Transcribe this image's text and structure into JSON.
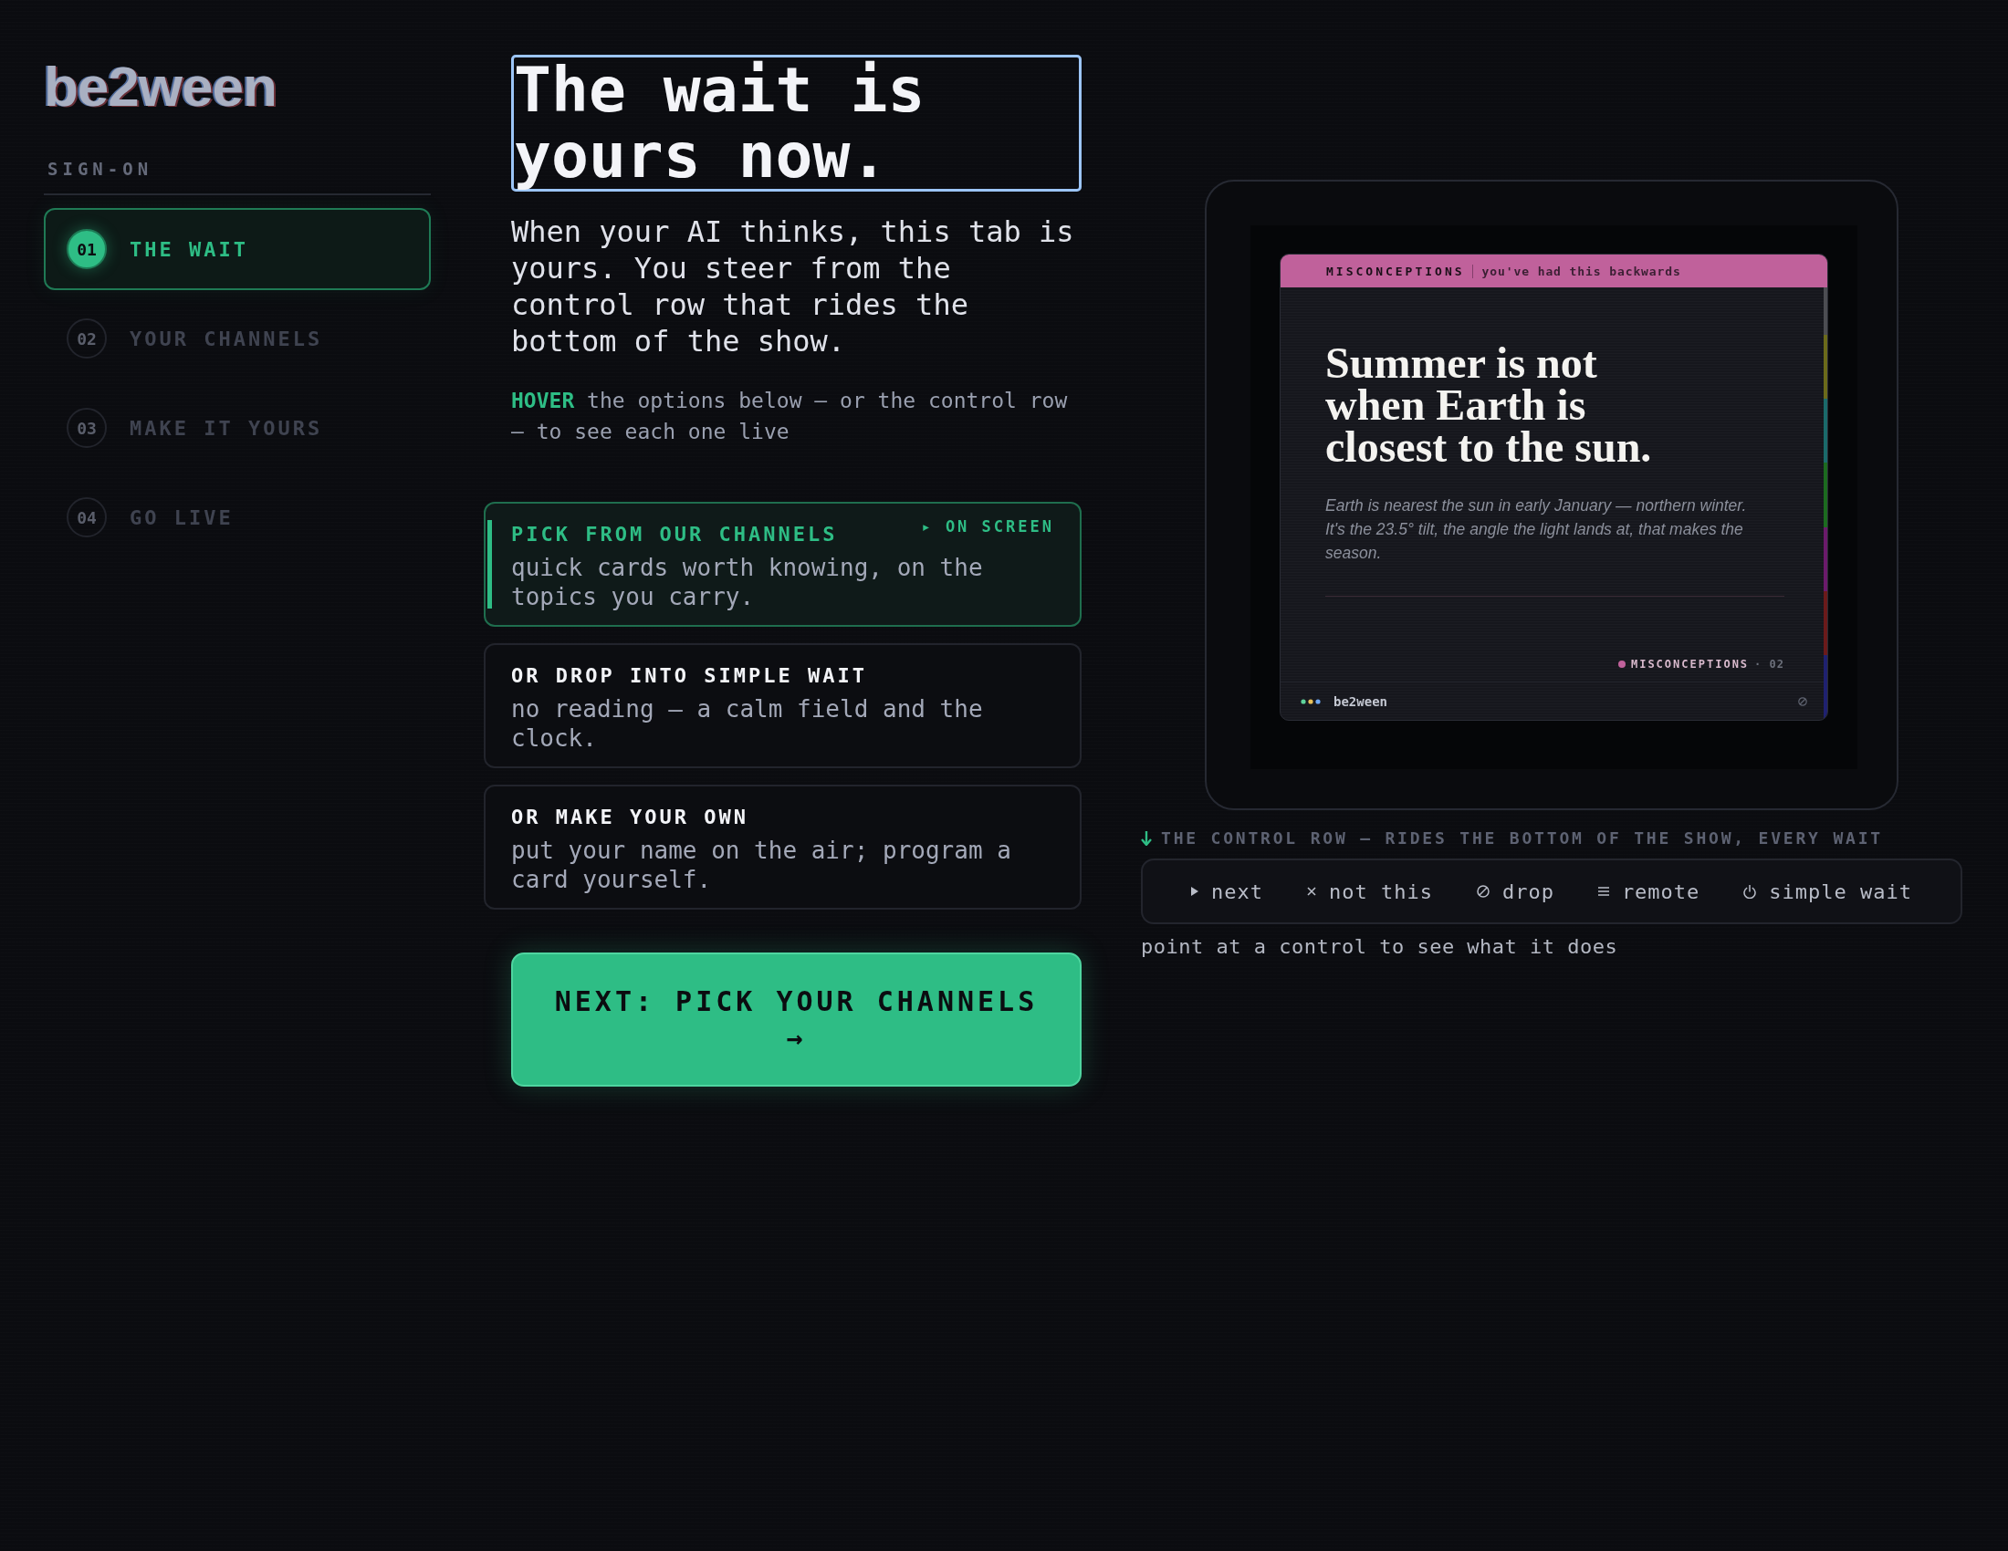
{
  "logo": {
    "text": "be2ween"
  },
  "sidebar": {
    "section_label": "SIGN-ON",
    "steps": [
      {
        "number": "01",
        "label": "THE WAIT",
        "selected": true
      },
      {
        "number": "02",
        "label": "YOUR CHANNELS",
        "selected": false
      },
      {
        "number": "03",
        "label": "MAKE IT YOURS",
        "selected": false
      },
      {
        "number": "04",
        "label": "GO LIVE",
        "selected": false
      }
    ]
  },
  "main": {
    "heading": "The wait is yours now.",
    "intro": "When your AI thinks, this tab is yours. You steer from the control row that rides the bottom of the show.",
    "hint": "**HOVER** the options below — or the control row — to see each one live",
    "options": [
      {
        "title": "PICK FROM OUR CHANNELS",
        "badge": "▸ ON SCREEN",
        "description": "quick cards worth knowing, on the topics you carry.",
        "selected": true
      },
      {
        "title": "OR DROP INTO SIMPLE WAIT",
        "description": "no reading — a calm field and the clock.",
        "selected": false
      },
      {
        "title": "OR MAKE YOUR OWN",
        "description": "put your name on the air; program a card yourself.",
        "selected": false
      }
    ],
    "next_button": "NEXT: PICK YOUR CHANNELS →"
  },
  "preview": {
    "category": "MISCONCEPTIONS",
    "tagline": "you've had this backwards",
    "title": "Summer is not when Earth is closest to the sun.",
    "body": "Earth is nearest the sun in early January — northern winter. It's the 23.5° tilt, the angle the light lands at, that makes the season.",
    "footer_category": "MISCONCEPTIONS",
    "footer_number": "· 02",
    "brand": "be2ween"
  },
  "control_row": {
    "label": "THE CONTROL ROW — RIDES THE BOTTOM OF THE SHOW, EVERY WAIT",
    "controls": [
      {
        "kind": "next",
        "label": "next"
      },
      {
        "kind": "not_this",
        "label": "not this"
      },
      {
        "kind": "drop",
        "label": "drop"
      },
      {
        "kind": "remote",
        "label": "remote"
      },
      {
        "kind": "simple_wait",
        "label": "simple wait"
      }
    ],
    "hint": "point at a control to see what it does"
  }
}
